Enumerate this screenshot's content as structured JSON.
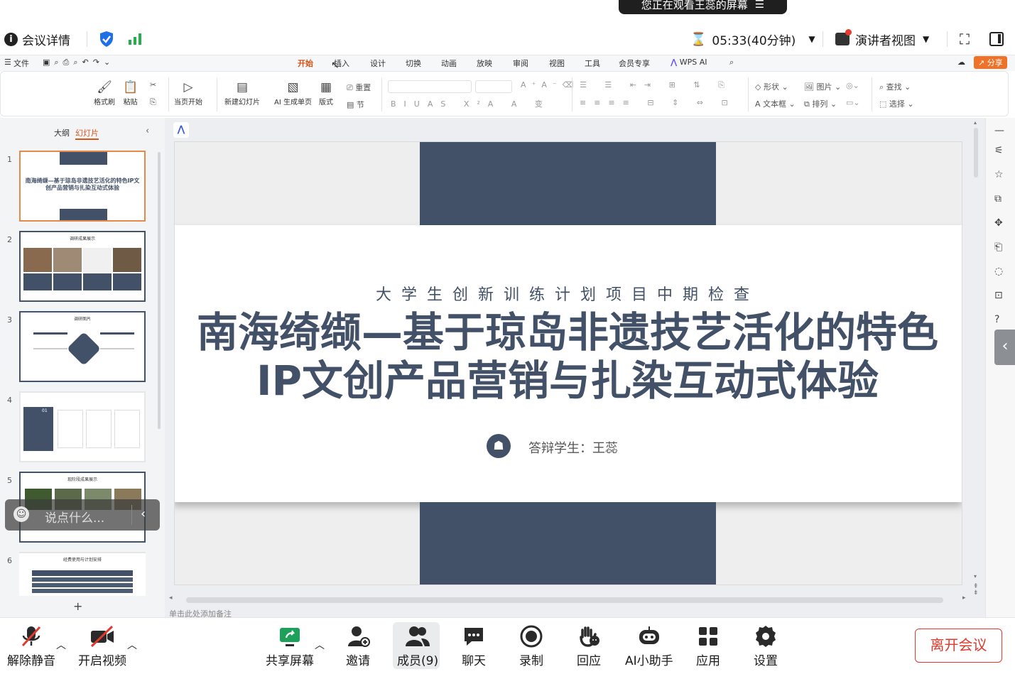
{
  "banner": {
    "text": "您正在观看王蕊的屏幕",
    "menu_icon": "list-icon"
  },
  "topbar": {
    "meeting_details": "会议详情",
    "timer": "05:33(40分钟)",
    "presenter_view": "演讲者视图"
  },
  "menubar": {
    "file": "文件",
    "tabs": [
      "开始",
      "插入",
      "设计",
      "切换",
      "动画",
      "放映",
      "审阅",
      "视图",
      "工具",
      "会员专享",
      "WPS AI"
    ],
    "share": "分享"
  },
  "ribbon": {
    "format_painter": "格式刷",
    "paste": "粘贴",
    "from_current": "当页开始",
    "new_slide": "新建幻灯片",
    "ai_page": "AI 生成单页",
    "layout": "版式",
    "reset": "重置",
    "section": "节",
    "shape": "形状",
    "picture": "图片",
    "find": "查找",
    "textbox": "文本框",
    "arrange": "排列",
    "select": "选择"
  },
  "leftpanel": {
    "tab_outline": "大纲",
    "tab_slides": "幻灯片",
    "slides": [
      {
        "num": "1",
        "title": "南海绮缬—基于琼岛非遗技艺活化的特色IP文创产品营销与扎染互动式体验"
      },
      {
        "num": "2",
        "title": "调研成果展示"
      },
      {
        "num": "3",
        "title": "调研图片"
      },
      {
        "num": "4",
        "title": "01"
      },
      {
        "num": "5",
        "title": "现阶段成果展示"
      },
      {
        "num": "6",
        "title": "经费使用与计划安排"
      }
    ],
    "add": "+"
  },
  "chat_overlay": {
    "placeholder": "说点什么..."
  },
  "slide": {
    "subtitle": "大学生创新训练计划项目中期检查",
    "title_line1": "南海绮缬—基于琼岛非遗技艺活化的特色",
    "title_line2": "IP文创产品营销与扎染互动式体验",
    "presenter": "答辩学生：王蕊",
    "accent_color": "#435168"
  },
  "notes_placeholder": "单击此处添加备注",
  "bottombar": {
    "unmute": "解除静音",
    "start_video": "开启视频",
    "share_screen": "共享屏幕",
    "invite": "邀请",
    "members": "成员(9)",
    "chat": "聊天",
    "record": "录制",
    "reactions": "回应",
    "ai_assistant": "AI小助手",
    "apps": "应用",
    "settings": "设置",
    "leave": "离开会议"
  }
}
